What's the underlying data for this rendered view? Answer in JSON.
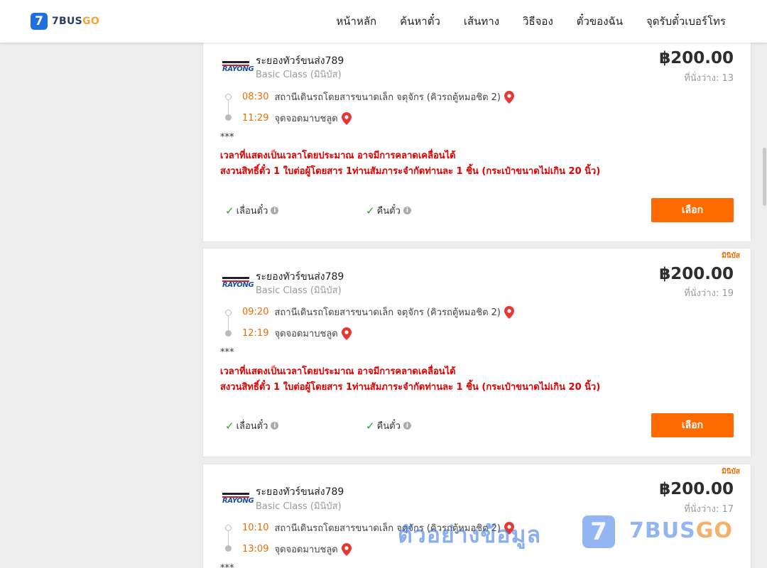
{
  "brand": {
    "number": "7",
    "name_part1": "7BUS",
    "name_part2": "GO"
  },
  "nav": [
    "หน้าหลัก",
    "ค้นหาตั๋ว",
    "เส้นทาง",
    "วิธีจอง",
    "ตั๋วของฉัน",
    "จุดรับตั๋วเบอร์โทร"
  ],
  "trips": [
    {
      "badge": "",
      "operator_logo_text": "RAYONG",
      "operator": "ระยองทัวร์ขนส่ง789",
      "class": "Basic Class (มินิบัส)",
      "price": "฿200.00",
      "seats": "ที่นั่งว่าง: 13",
      "depart_time": "08:30",
      "depart_place": "สถานีเดินรถโดยสารขนาดเล็ก จตุจักร (คิวรถตู้หมอชิต 2)",
      "arrive_time": "11:29",
      "arrive_place": "จุดจอดมาบชลูด",
      "note_stars": "***",
      "warning_1": "เวลาที่แสดงเป็นเวลาโดยประมาณ อาจมีการคลาดเคลื่อนได้",
      "warning_2": "สงวนสิทธิ์ตั๋ว 1 ใบต่อผู้โดยสาร 1ท่านสัมภาระจำกัดท่านละ 1 ชิ้น (กระเป๋าขนาดไม่เกิน 20 นิ้ว)",
      "feature_change": "เลื่อนตั๋ว",
      "feature_refund": "คืนตั๋ว",
      "select_label": "เลือก"
    },
    {
      "badge": "มินิบัส",
      "operator_logo_text": "RAYONG",
      "operator": "ระยองทัวร์ขนส่ง789",
      "class": "Basic Class (มินิบัส)",
      "price": "฿200.00",
      "seats": "ที่นั่งว่าง: 19",
      "depart_time": "09:20",
      "depart_place": "สถานีเดินรถโดยสารขนาดเล็ก จตุจักร (คิวรถตู้หมอชิต 2)",
      "arrive_time": "12:19",
      "arrive_place": "จุดจอดมาบชลูด",
      "note_stars": "***",
      "warning_1": "เวลาที่แสดงเป็นเวลาโดยประมาณ อาจมีการคลาดเคลื่อนได้",
      "warning_2": "สงวนสิทธิ์ตั๋ว 1 ใบต่อผู้โดยสาร 1ท่านสัมภาระจำกัดท่านละ 1 ชิ้น (กระเป๋าขนาดไม่เกิน 20 นิ้ว)",
      "feature_change": "เลื่อนตั๋ว",
      "feature_refund": "คืนตั๋ว",
      "select_label": "เลือก"
    },
    {
      "badge": "มินิบัส",
      "operator_logo_text": "RAYONG",
      "operator": "ระยองทัวร์ขนส่ง789",
      "class": "Basic Class (มินิบัส)",
      "price": "฿200.00",
      "seats": "ที่นั่งว่าง: 17",
      "depart_time": "10:10",
      "depart_place": "สถานีเดินรถโดยสารขนาดเล็ก จตุจักร (คิวรถตู้หมอชิต 2)",
      "arrive_time": "13:09",
      "arrive_place": "จุดจอดมาบชลูด",
      "note_stars": "***"
    }
  ],
  "watermark": {
    "text": "ตัวอย่างข้อมูล",
    "logo_number": "7",
    "brand_part1": "7BUS",
    "brand_part2": "GO"
  },
  "colors": {
    "accent": "#ff6a00",
    "time": "#ef6c00",
    "warning": "#e00000",
    "brand_blue": "#1f6fe0"
  },
  "icons": [
    "check-icon",
    "info-icon",
    "map-pin-icon"
  ]
}
